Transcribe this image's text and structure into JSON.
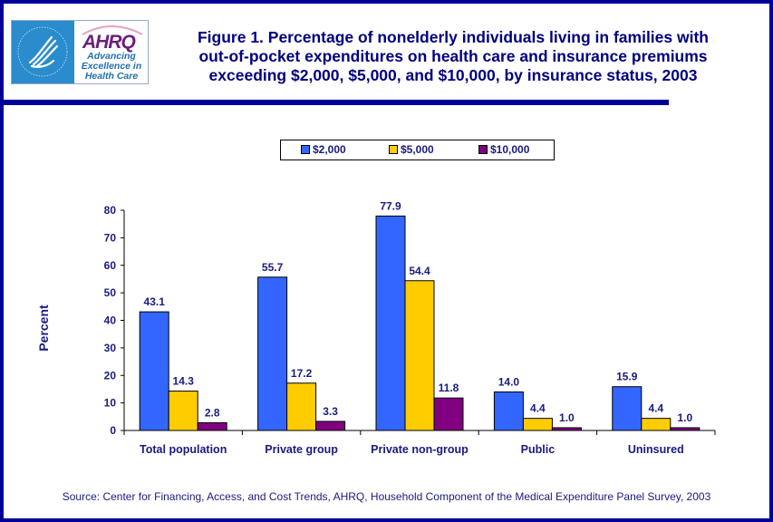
{
  "header": {
    "logo_hhs_alt": "Department of Health & Human Services USA",
    "logo_ahrq_mark": "AHRQ",
    "logo_ahrq_tagline": [
      "Advancing",
      "Excellence in",
      "Health Care"
    ],
    "title_lines": [
      "Figure 1. Percentage of nonelderly individuals living in families with",
      "out-of-pocket expenditures on health care and insurance premiums",
      "exceeding $2,000, $5,000, and $10,000, by insurance status, 2003"
    ]
  },
  "footer": {
    "source": "Source: Center for Financing, Access, and Cost Trends, AHRQ, Household Component of the Medical Expenditure Panel Survey, 2003"
  },
  "colors": {
    "frame": "#000099",
    "text": "#1a1a80",
    "series_2000": "#3366ff",
    "series_5000": "#ffcc00",
    "series_10000": "#800080"
  },
  "chart_data": {
    "type": "bar",
    "title": "Figure 1. Percentage of nonelderly individuals living in families with out-of-pocket expenditures on health care and insurance premiums exceeding $2,000, $5,000, and $10,000, by insurance status, 2003",
    "xlabel": "",
    "ylabel": "Percent",
    "ylim": [
      0,
      80
    ],
    "yticks": [
      0,
      10,
      20,
      30,
      40,
      50,
      60,
      70,
      80
    ],
    "grid": false,
    "legend_position": "top-center",
    "categories": [
      "Total population",
      "Private group",
      "Private non-group",
      "Public",
      "Uninsured"
    ],
    "series": [
      {
        "name": "$2,000",
        "color": "#3366ff",
        "values": [
          43.1,
          55.7,
          77.9,
          14.0,
          15.9
        ],
        "labels": [
          "43.1",
          "55.7",
          "77.9",
          "14.0",
          "15.9"
        ]
      },
      {
        "name": "$5,000",
        "color": "#ffcc00",
        "values": [
          14.3,
          17.2,
          54.4,
          4.4,
          4.4
        ],
        "labels": [
          "14.3",
          "17.2",
          "54.4",
          "4.4",
          "4.4"
        ]
      },
      {
        "name": "$10,000",
        "color": "#800080",
        "values": [
          2.8,
          3.3,
          11.8,
          1.0,
          1.0
        ],
        "labels": [
          "2.8",
          "3.3",
          "11.8",
          "1.0",
          "1.0"
        ]
      }
    ]
  }
}
